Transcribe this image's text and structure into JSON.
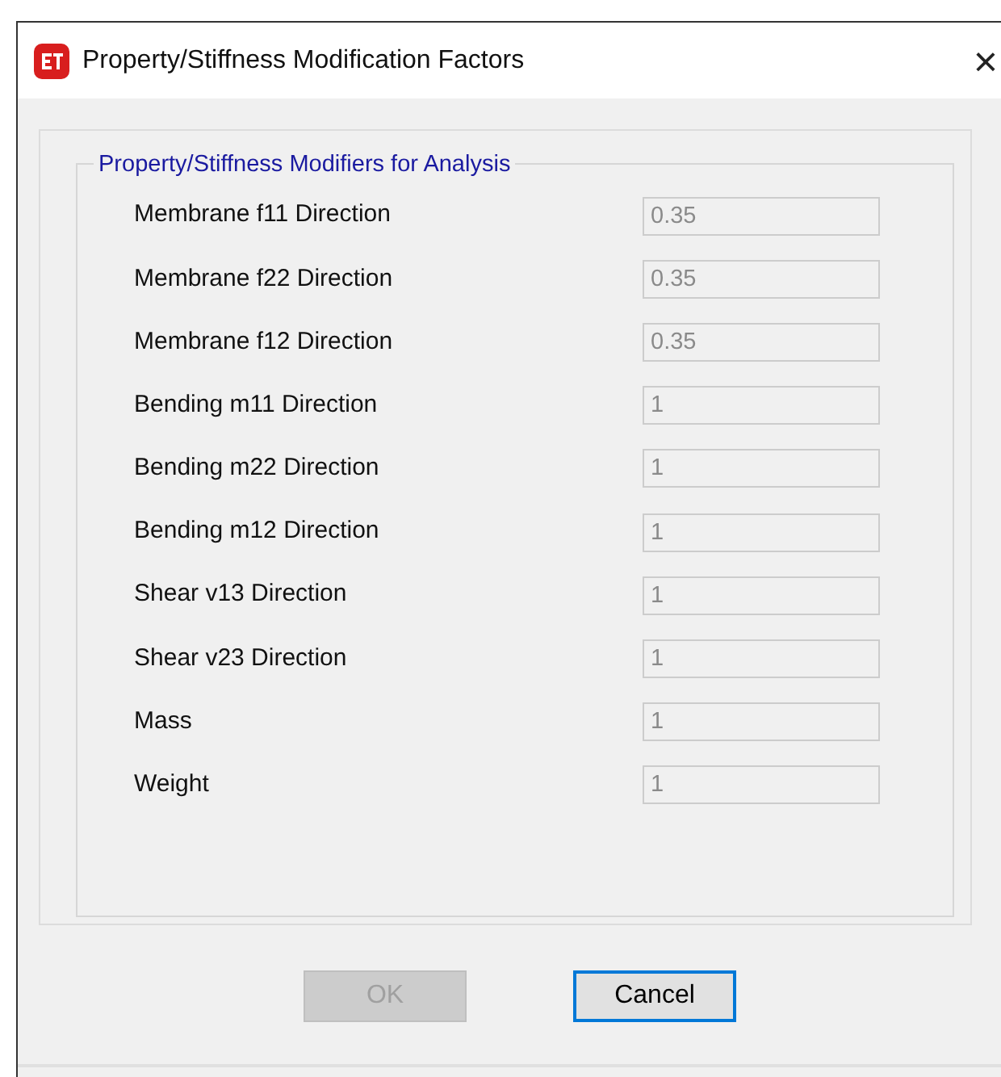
{
  "window": {
    "title": "Property/Stiffness Modification Factors",
    "close": "×"
  },
  "group": {
    "title": "Property/Stiffness Modifiers for Analysis"
  },
  "fields": [
    {
      "label": "Membrane f11 Direction",
      "value": "0.35",
      "disabled": true
    },
    {
      "label": "Membrane f22 Direction",
      "value": "0.35",
      "disabled": true
    },
    {
      "label": "Membrane f12 Direction",
      "value": "0.35",
      "disabled": true
    },
    {
      "label": "Bending m11 Direction",
      "value": "1",
      "disabled": true
    },
    {
      "label": "Bending m22 Direction",
      "value": "1",
      "disabled": true
    },
    {
      "label": "Bending m12 Direction",
      "value": "1",
      "disabled": true
    },
    {
      "label": "Shear v13 Direction",
      "value": "1",
      "disabled": true
    },
    {
      "label": "Shear v23 Direction",
      "value": "1",
      "disabled": true
    },
    {
      "label": "Mass",
      "value": "1",
      "disabled": true
    },
    {
      "label": "Weight",
      "value": "1",
      "disabled": true
    }
  ],
  "buttons": [
    {
      "label": "OK",
      "disabled": true,
      "focused": false
    },
    {
      "label": "Cancel",
      "disabled": false,
      "focused": true
    }
  ]
}
